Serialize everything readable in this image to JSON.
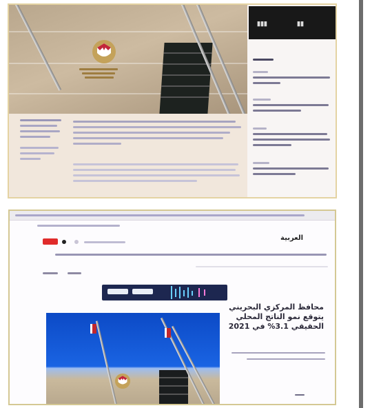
{
  "article": {
    "kicker": "",
    "headline": "محافظ المركزي البحريني يتوقع نمو الناتج المحلي الحقيقي 3.1% في 2021",
    "summary": ""
  },
  "news_site": {
    "logo": "العربية"
  },
  "colors": {
    "accent_red": "#e02b2b",
    "link_blue": "#1a64e3",
    "divider": "#6d6d6d"
  },
  "icons": [
    "bahrain-emblem",
    "flag",
    "flagpole"
  ]
}
